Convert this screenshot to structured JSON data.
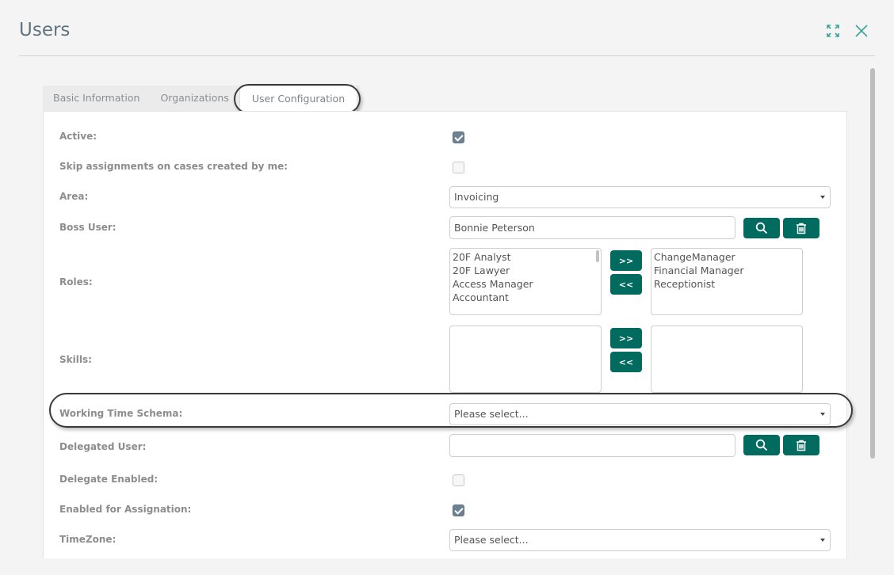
{
  "modal": {
    "title": "Users",
    "icons": [
      "expand-icon",
      "close-icon"
    ],
    "accent_color": "#006b5e"
  },
  "tabs": [
    {
      "label": "Basic Information",
      "active": false
    },
    {
      "label": "Organizations",
      "active": false
    },
    {
      "label": "User Configuration",
      "active": true
    }
  ],
  "form": {
    "active": {
      "label": "Active:",
      "checked": true
    },
    "skip_assignments": {
      "label": "Skip assignments on cases created by me:",
      "checked": false
    },
    "area": {
      "label": "Area:",
      "value": "Invoicing"
    },
    "boss_user": {
      "label": "Boss User:",
      "value": "Bonnie Peterson",
      "search_icon": "search-icon",
      "delete_icon": "trash-icon"
    },
    "roles": {
      "label": "Roles:",
      "available": [
        "20F Analyst",
        "20F Lawyer",
        "Access Manager",
        "Accountant"
      ],
      "selected": [
        "ChangeManager",
        "Financial Manager",
        "Receptionist"
      ],
      "add_label": ">>",
      "remove_label": "<<"
    },
    "skills": {
      "label": "Skills:",
      "available": [],
      "selected": [],
      "add_label": ">>",
      "remove_label": "<<"
    },
    "working_time_schema": {
      "label": "Working Time Schema:",
      "value": "Please select..."
    },
    "delegated_user": {
      "label": "Delegated User:",
      "value": ""
    },
    "delegate_enabled": {
      "label": "Delegate Enabled:",
      "checked": false
    },
    "enabled_for_assignation": {
      "label": "Enabled for Assignation:",
      "checked": true
    },
    "timezone": {
      "label": "TimeZone:",
      "value": "Please select..."
    }
  }
}
